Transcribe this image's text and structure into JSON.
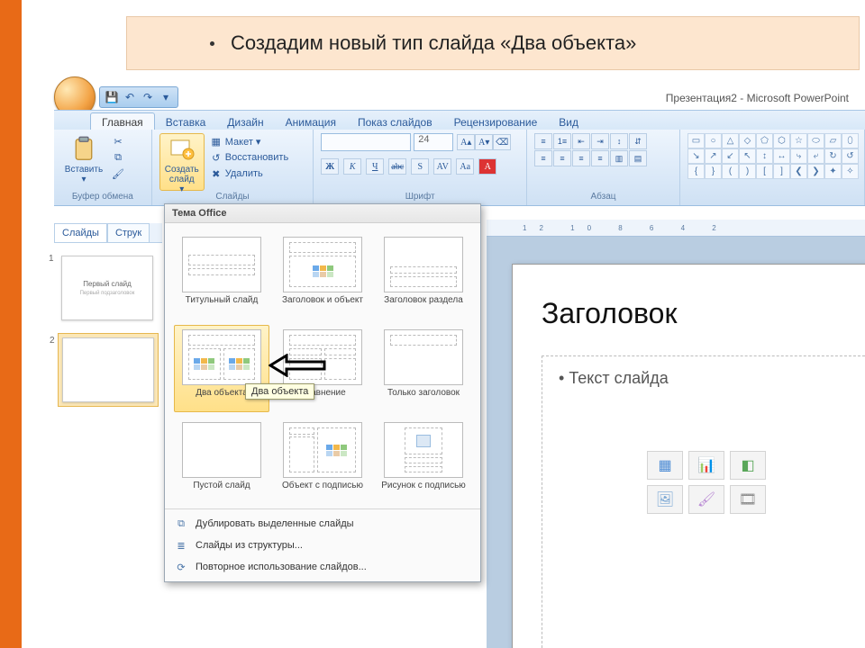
{
  "callout": "Создадим новый тип слайда «Два объекта»",
  "app_title": "Презентация2 - Microsoft PowerPoint",
  "qat": {
    "save": "💾",
    "undo": "↶",
    "redo": "↷"
  },
  "tabs": [
    "Главная",
    "Вставка",
    "Дизайн",
    "Анимация",
    "Показ слайдов",
    "Рецензирование",
    "Вид"
  ],
  "ribbon": {
    "clipboard": {
      "label": "Буфер обмена",
      "paste": "Вставить",
      "cut": "✂",
      "copy": "⧉",
      "painter": "🖌"
    },
    "slides": {
      "label": "Слайды",
      "new": "Создать слайд",
      "layout": "Макет ▾",
      "reset": "Восстановить",
      "delete": "Удалить"
    },
    "font": {
      "label": "Шрифт",
      "size": "24",
      "bold": "Ж",
      "italic": "К",
      "underline": "Ч",
      "strike": "abc",
      "shadow": "S",
      "spacing": "AV",
      "case": "Aa",
      "grow": "A▴",
      "shrink": "A▾",
      "clear": "⌫"
    },
    "paragraph": {
      "label": "Абзац"
    }
  },
  "leftpanel": {
    "tab_slides": "Слайды",
    "tab_outline": "Струк",
    "thumb1_title": "Первый слайд",
    "thumb1_sub": "Первый подзаголовок"
  },
  "gallery": {
    "title": "Тема Office",
    "items": [
      {
        "label": "Титульный слайд"
      },
      {
        "label": "Заголовок и объект"
      },
      {
        "label": "Заголовок раздела"
      },
      {
        "label": "Два объекта"
      },
      {
        "label": "Сравнение"
      },
      {
        "label": "Только заголовок"
      },
      {
        "label": "Пустой слайд"
      },
      {
        "label": "Объект с подписью"
      },
      {
        "label": "Рисунок с подписью"
      }
    ],
    "tooltip": "Два объекта",
    "footer": {
      "dup": "Дублировать выделенные слайды",
      "outline": "Слайды из структуры...",
      "reuse": "Повторное использование слайдов..."
    }
  },
  "ruler": "12 10 8 6 4 2",
  "slide": {
    "title": "Заголовок",
    "body": "Текст слайда",
    "right_bullet": "•"
  },
  "shapes": [
    "▭",
    "○",
    "△",
    "◇",
    "⬠",
    "⬡",
    "☆",
    "⬭",
    "▱",
    "⬯",
    "↘",
    "↗",
    "↙",
    "↖",
    "↕",
    "↔",
    "⤷",
    "⤶",
    "↻",
    "↺",
    "{",
    "}",
    "(",
    ")",
    "[",
    "]",
    "❮",
    "❯",
    "✦",
    "✧"
  ]
}
